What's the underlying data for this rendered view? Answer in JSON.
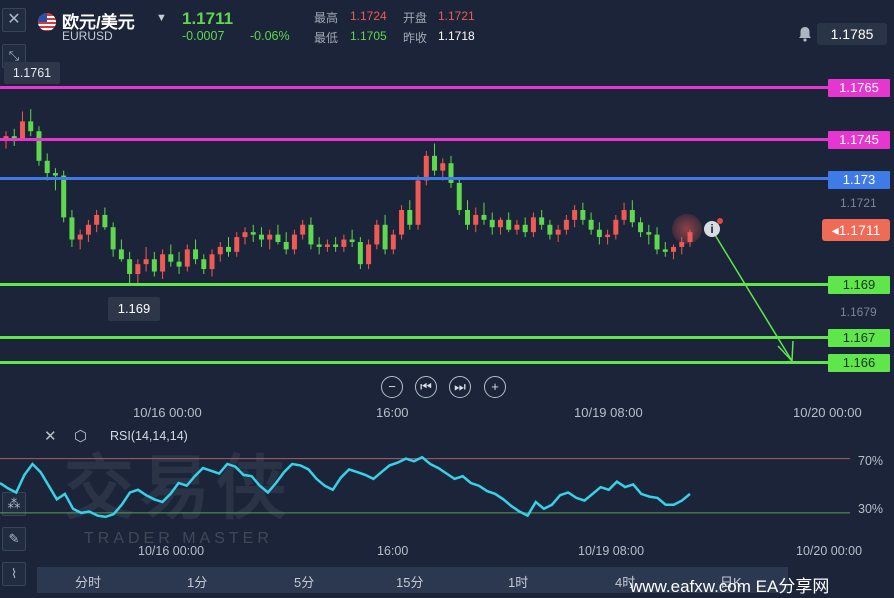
{
  "header": {
    "title": "欧元/美元",
    "symbol": "EURUSD",
    "price": "1.1711",
    "change": "-0.0007",
    "change_pct": "-0.06%",
    "high_label": "最高",
    "high": "1.1724",
    "open_label": "开盘",
    "open": "1.1721",
    "low_label": "最低",
    "low": "1.1705",
    "prev_label": "昨收",
    "prev": "1.1718",
    "top_right_price": "1.1785",
    "close_icon": "close-icon",
    "bell_icon": "bell-icon"
  },
  "levels": {
    "l1765": "1.1765",
    "l1745": "1.1745",
    "l173": "1.173",
    "l1721": "1.1721",
    "current": "1.1711",
    "l169": "1.169",
    "l1679": "1.1679",
    "l167": "1.167",
    "l166": "1.166"
  },
  "callouts": {
    "high_mark": "1.1761",
    "low_mark": "1.169"
  },
  "colors": {
    "magenta": "#e536d0",
    "blue": "#3e7be6",
    "green": "#5ee64b",
    "up": "#ef5a55",
    "down": "#5fd74e",
    "rsi": "#35d2e8"
  },
  "time_axis": [
    "10/16 00:00",
    "16:00",
    "10/19 08:00",
    "10/20 00:00"
  ],
  "nav_controls": [
    "zoom-out",
    "jump-start",
    "jump-end",
    "zoom-in"
  ],
  "rsi": {
    "title": "RSI(14,14,14)",
    "level_70": "70%",
    "level_30": "30%",
    "values": [
      52,
      48,
      45,
      58,
      66,
      60,
      50,
      40,
      44,
      33,
      30,
      31,
      28,
      27,
      29,
      36,
      45,
      47,
      43,
      40,
      38,
      44,
      52,
      50,
      57,
      63,
      61,
      59,
      66,
      64,
      58,
      57,
      50,
      45,
      52,
      60,
      66,
      65,
      62,
      55,
      50,
      47,
      56,
      62,
      60,
      58,
      55,
      60,
      65,
      67,
      70,
      68,
      71,
      66,
      63,
      59,
      55,
      57,
      52,
      50,
      46,
      44,
      40,
      35,
      31,
      28,
      38,
      33,
      36,
      43,
      45,
      41,
      39,
      44,
      49,
      47,
      53,
      49,
      51,
      44,
      42,
      41,
      36,
      36,
      39,
      44
    ]
  },
  "timeframes": [
    "分时",
    "1分",
    "5分",
    "15分",
    "1时",
    "4时",
    "日K"
  ],
  "watermark": {
    "title": "交易侠",
    "subtitle": "TRADER MASTER"
  },
  "footer": "www.eafxw.com  EA分享网",
  "chart_data": {
    "type": "candlestick",
    "ylim": [
      1.1655,
      1.1785
    ],
    "candles": [
      [
        1.1748,
        1.1752,
        1.1745,
        1.175
      ],
      [
        1.175,
        1.1753,
        1.1746,
        1.1749
      ],
      [
        1.1749,
        1.176,
        1.1748,
        1.1756
      ],
      [
        1.1756,
        1.1761,
        1.175,
        1.1752
      ],
      [
        1.1752,
        1.1754,
        1.1738,
        1.174
      ],
      [
        1.174,
        1.1743,
        1.1732,
        1.1735
      ],
      [
        1.1735,
        1.1737,
        1.1728,
        1.1734
      ],
      [
        1.1734,
        1.1736,
        1.1715,
        1.1717
      ],
      [
        1.1717,
        1.172,
        1.1705,
        1.1708
      ],
      [
        1.1708,
        1.1712,
        1.1704,
        1.171
      ],
      [
        1.171,
        1.1716,
        1.1707,
        1.1714
      ],
      [
        1.1714,
        1.172,
        1.1711,
        1.1718
      ],
      [
        1.1718,
        1.1721,
        1.1712,
        1.1713
      ],
      [
        1.1713,
        1.1715,
        1.1701,
        1.1704
      ],
      [
        1.1704,
        1.1708,
        1.1699,
        1.17
      ],
      [
        1.17,
        1.1703,
        1.169,
        1.1694
      ],
      [
        1.1694,
        1.17,
        1.169,
        1.1698
      ],
      [
        1.1698,
        1.1705,
        1.1695,
        1.17
      ],
      [
        1.17,
        1.1703,
        1.1693,
        1.1695
      ],
      [
        1.1695,
        1.1704,
        1.1692,
        1.1702
      ],
      [
        1.1702,
        1.1706,
        1.1697,
        1.1699
      ],
      [
        1.1699,
        1.1703,
        1.1694,
        1.1697
      ],
      [
        1.1697,
        1.1706,
        1.1695,
        1.1704
      ],
      [
        1.1704,
        1.1708,
        1.1698,
        1.17
      ],
      [
        1.17,
        1.1702,
        1.1694,
        1.1696
      ],
      [
        1.1696,
        1.1704,
        1.1693,
        1.1702
      ],
      [
        1.1702,
        1.1707,
        1.1699,
        1.1705
      ],
      [
        1.1705,
        1.1709,
        1.1701,
        1.1703
      ],
      [
        1.1703,
        1.1711,
        1.1701,
        1.1709
      ],
      [
        1.1709,
        1.1713,
        1.1706,
        1.1711
      ],
      [
        1.1711,
        1.1714,
        1.1707,
        1.171
      ],
      [
        1.171,
        1.1713,
        1.1705,
        1.1708
      ],
      [
        1.1708,
        1.1712,
        1.1704,
        1.171
      ],
      [
        1.171,
        1.1714,
        1.1706,
        1.1707
      ],
      [
        1.1707,
        1.1711,
        1.1702,
        1.1704
      ],
      [
        1.1704,
        1.1712,
        1.1702,
        1.171
      ],
      [
        1.171,
        1.1716,
        1.1708,
        1.1714
      ],
      [
        1.1714,
        1.1717,
        1.1704,
        1.1706
      ],
      [
        1.1706,
        1.1709,
        1.1702,
        1.1705
      ],
      [
        1.1705,
        1.1708,
        1.1703,
        1.1706
      ],
      [
        1.1706,
        1.1709,
        1.1703,
        1.1705
      ],
      [
        1.1705,
        1.171,
        1.1703,
        1.1708
      ],
      [
        1.1708,
        1.1712,
        1.1705,
        1.1707
      ],
      [
        1.1707,
        1.1709,
        1.1696,
        1.1698
      ],
      [
        1.1698,
        1.1708,
        1.1696,
        1.1706
      ],
      [
        1.1706,
        1.1716,
        1.1704,
        1.1714
      ],
      [
        1.1714,
        1.1718,
        1.1702,
        1.1704
      ],
      [
        1.1704,
        1.1712,
        1.1702,
        1.171
      ],
      [
        1.171,
        1.1722,
        1.1708,
        1.172
      ],
      [
        1.172,
        1.1724,
        1.1712,
        1.1714
      ],
      [
        1.1714,
        1.1734,
        1.1712,
        1.1732
      ],
      [
        1.1732,
        1.1744,
        1.173,
        1.1742
      ],
      [
        1.1742,
        1.1747,
        1.1734,
        1.1736
      ],
      [
        1.1736,
        1.1741,
        1.1732,
        1.1739
      ],
      [
        1.1739,
        1.1742,
        1.1729,
        1.1731
      ],
      [
        1.1731,
        1.1733,
        1.1718,
        1.172
      ],
      [
        1.172,
        1.1724,
        1.1712,
        1.1714
      ],
      [
        1.1714,
        1.1721,
        1.1711,
        1.1718
      ],
      [
        1.1718,
        1.1723,
        1.1714,
        1.1716
      ],
      [
        1.1716,
        1.1719,
        1.171,
        1.1713
      ],
      [
        1.1713,
        1.1717,
        1.171,
        1.1716
      ],
      [
        1.1716,
        1.1719,
        1.1711,
        1.1712
      ],
      [
        1.1712,
        1.1716,
        1.171,
        1.1714
      ],
      [
        1.1714,
        1.1717,
        1.1709,
        1.1711
      ],
      [
        1.1711,
        1.1719,
        1.1709,
        1.1717
      ],
      [
        1.1717,
        1.172,
        1.1712,
        1.1714
      ],
      [
        1.1714,
        1.1716,
        1.1708,
        1.171
      ],
      [
        1.171,
        1.1714,
        1.1707,
        1.1712
      ],
      [
        1.1712,
        1.1718,
        1.171,
        1.1716
      ],
      [
        1.1716,
        1.1722,
        1.1713,
        1.172
      ],
      [
        1.172,
        1.1723,
        1.1714,
        1.1716
      ],
      [
        1.1716,
        1.1719,
        1.171,
        1.1712
      ],
      [
        1.1712,
        1.1715,
        1.1706,
        1.1709
      ],
      [
        1.1709,
        1.1712,
        1.1706,
        1.171
      ],
      [
        1.171,
        1.1718,
        1.1708,
        1.1716
      ],
      [
        1.1716,
        1.1723,
        1.1714,
        1.172
      ],
      [
        1.172,
        1.1724,
        1.1713,
        1.1715
      ],
      [
        1.1715,
        1.1717,
        1.1709,
        1.1711
      ],
      [
        1.1711,
        1.1714,
        1.1706,
        1.171
      ],
      [
        1.171,
        1.1713,
        1.1702,
        1.1704
      ],
      [
        1.1704,
        1.1707,
        1.1701,
        1.1703
      ],
      [
        1.1703,
        1.1706,
        1.17,
        1.1705
      ],
      [
        1.1705,
        1.1709,
        1.1702,
        1.1707
      ],
      [
        1.1707,
        1.1712,
        1.1705,
        1.1711
      ]
    ]
  }
}
